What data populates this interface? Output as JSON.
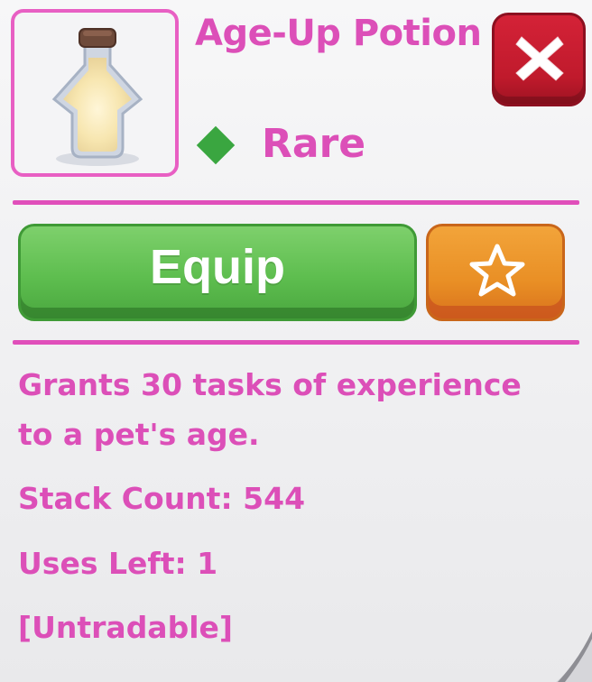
{
  "item": {
    "title": "Age-Up Potion",
    "rarity": "Rare",
    "icon": "potion-bottle-icon"
  },
  "close_button": {
    "icon": "close-x-icon"
  },
  "actions": {
    "equip_label": "Equip",
    "favorite_icon": "star-outline-icon"
  },
  "details": {
    "description_line1": "Grants 30 tasks of experience",
    "description_line2": "to a pet's age.",
    "stack_count": "Stack Count: 544",
    "uses_left": "Uses Left: 1",
    "tradable_status": "[Untradable]"
  },
  "colors": {
    "accent_pink": "#dc4fb8",
    "rarity_green": "#3aa640",
    "equip_green": "#5ebe4f",
    "favorite_orange": "#e98f25",
    "close_red": "#c01a2c"
  }
}
